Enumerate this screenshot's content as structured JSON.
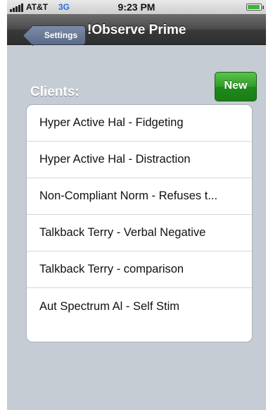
{
  "status_bar": {
    "carrier": "AT&T",
    "network": "3G",
    "time": "9:23 PM"
  },
  "nav_bar": {
    "back_label": "Settings",
    "title": "!Observe Prime"
  },
  "section": {
    "header": "Clients:",
    "new_label": "New"
  },
  "clients": [
    "Hyper Active Hal - Fidgeting",
    "Hyper Active Hal - Distraction",
    "Non-Compliant Norm - Refuses t...",
    "Talkback Terry - Verbal Negative",
    "Talkback Terry - comparison",
    "Aut Spectrum Al - Self Stim"
  ],
  "colors": {
    "background": "#c5ccd4",
    "nav_bar": "#3a3a3a",
    "new_button": "#2f9e27",
    "back_button": "#5a6a88"
  },
  "icons": {
    "signal": "signal-bars-icon",
    "battery": "battery-icon"
  }
}
